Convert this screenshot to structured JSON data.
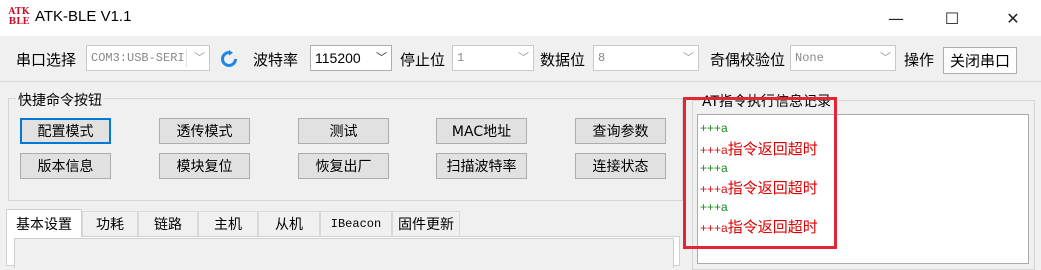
{
  "window": {
    "title": "ATK-BLE V1.1",
    "icon_text": [
      "ATK",
      "BLE"
    ],
    "controls": [
      "—",
      "☐",
      "✕"
    ]
  },
  "topbar": {
    "port_label": "串口选择",
    "port_value": "COM3:USB-SERI",
    "baud_label": "波特率",
    "baud_value": "115200",
    "stopbit_label": "停止位",
    "stopbit_value": "1",
    "databit_label": "数据位",
    "databit_value": "8",
    "parity_label": "奇偶校验位",
    "parity_value": "None",
    "action_label": "操作",
    "close_port_label": "关闭串口"
  },
  "quick": {
    "title": "快捷命令按钮",
    "buttons": [
      "配置模式",
      "透传模式",
      "测试",
      "MAC地址",
      "查询参数",
      "版本信息",
      "模块复位",
      "恢复出厂",
      "扫描波特率",
      "连接状态"
    ]
  },
  "tabs": [
    "基本设置",
    "功耗",
    "链路",
    "主机",
    "从机",
    "IBeacon",
    "固件更新"
  ],
  "log": {
    "title": "AT指令执行信息记录",
    "lines": [
      {
        "prefix": "+++a",
        "message": ""
      },
      {
        "prefix": "+++a",
        "message": "指令返回超时"
      },
      {
        "prefix": "+++a",
        "message": ""
      },
      {
        "prefix": "+++a",
        "message": "指令返回超时"
      },
      {
        "prefix": "+++a",
        "message": ""
      },
      {
        "prefix": "+++a",
        "message": "指令返回超时"
      }
    ]
  },
  "colors": {
    "highlight": "#e32636",
    "log_ok": "#1a8a1a",
    "log_error": "#e00000",
    "accent": "#0078d7"
  }
}
